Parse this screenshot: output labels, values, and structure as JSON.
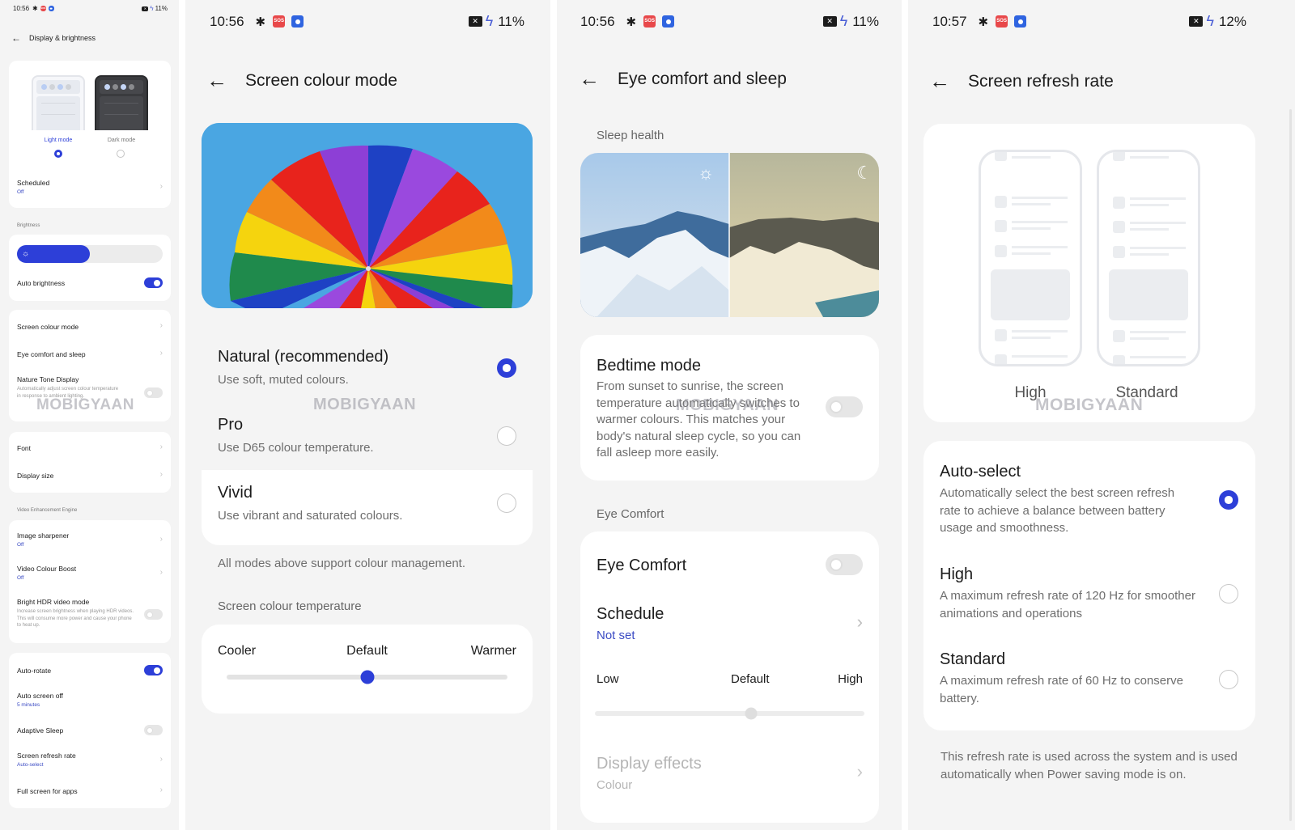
{
  "colors": {
    "accent": "#2d3fd8",
    "background": "#f4f4f4",
    "card": "#ffffff",
    "subtitle_link": "#3b4bc4",
    "secondary_text": "#6e6e6e"
  },
  "status_bars": [
    {
      "time": "10:56",
      "battery": "11%",
      "icons": [
        "gear-icon",
        "sos-icon",
        "app-icon",
        "no-sim-icon",
        "charging-bolt-icon"
      ],
      "sos": "SOS",
      "x": "✕"
    },
    {
      "time": "10:56",
      "battery": "11%",
      "icons": [
        "gear-icon",
        "sos-icon",
        "app-icon",
        "no-sim-icon",
        "charging-bolt-icon"
      ],
      "sos": "SOS",
      "x": "✕"
    },
    {
      "time": "10:56",
      "battery": "11%",
      "icons": [
        "gear-icon",
        "sos-icon",
        "app-icon",
        "no-sim-icon",
        "charging-bolt-icon"
      ],
      "sos": "SOS",
      "x": "✕"
    },
    {
      "time": "10:57",
      "battery": "12%",
      "icons": [
        "gear-icon",
        "sos-icon",
        "app-icon",
        "no-sim-icon",
        "charging-bolt-icon"
      ],
      "sos": "SOS",
      "x": "✕"
    }
  ],
  "watermark": "MOBIGYAAN",
  "display_brightness": {
    "title": "Display & brightness",
    "theme": {
      "light_label": "Light mode",
      "dark_label": "Dark mode",
      "selected": "light"
    },
    "scheduled": {
      "title": "Scheduled",
      "value": "Off"
    },
    "brightness_section": "Brightness",
    "brightness_level": 0.5,
    "auto_brightness": {
      "label": "Auto brightness",
      "on": true
    },
    "group1": [
      {
        "title": "Screen colour mode"
      },
      {
        "title": "Eye comfort and sleep"
      }
    ],
    "nature_tone": {
      "title": "Nature Tone Display",
      "desc": "Automatically adjust screen colour temperature in response to ambient lighting.",
      "on": false
    },
    "font": "Font",
    "display_size": "Display size",
    "video_section": "Video Enhancement Engine",
    "image_sharpener": {
      "title": "Image sharpener",
      "value": "Off"
    },
    "video_colour_boost": {
      "title": "Video Colour Boost",
      "value": "Off"
    },
    "bright_hdr": {
      "title": "Bright HDR video mode",
      "desc": "Increase screen brightness when playing HDR videos. This will consume more power and cause your phone to heat up.",
      "on": false
    },
    "auto_rotate": {
      "title": "Auto-rotate",
      "on": true
    },
    "auto_screen_off": {
      "title": "Auto screen off",
      "value": "5 minutes"
    },
    "adaptive_sleep": {
      "title": "Adaptive Sleep",
      "on": false
    },
    "refresh_rate": {
      "title": "Screen refresh rate",
      "value": "Auto-select"
    },
    "full_screen": {
      "title": "Full screen for apps"
    }
  },
  "screen_colour_mode": {
    "title": "Screen colour mode",
    "options": [
      {
        "title": "Natural (recommended)",
        "desc": "Use soft, muted colours.",
        "selected": true
      },
      {
        "title": "Pro",
        "desc": "Use D65 colour temperature.",
        "selected": false
      },
      {
        "title": "Vivid",
        "desc": "Use vibrant and saturated colours.",
        "selected": false
      }
    ],
    "note": "All modes above support colour management.",
    "temperature_section": "Screen colour temperature",
    "temperature": {
      "min_label": "Cooler",
      "mid_label": "Default",
      "max_label": "Warmer",
      "value": 0.5
    }
  },
  "eye_comfort_sleep": {
    "title": "Eye comfort and sleep",
    "sleep_section": "Sleep health",
    "bedtime": {
      "title": "Bedtime mode",
      "desc": "From sunset to sunrise, the screen temperature automatically switches to warmer colours. This matches your body's natural sleep cycle, so you can fall asleep more easily.",
      "on": false
    },
    "eye_section": "Eye Comfort",
    "eye_comfort": {
      "title": "Eye Comfort",
      "on": false
    },
    "schedule": {
      "title": "Schedule",
      "value": "Not set"
    },
    "intensity": {
      "min_label": "Low",
      "mid_label": "Default",
      "max_label": "High",
      "value": 0.58,
      "disabled": true
    },
    "display_effects": {
      "title": "Display effects",
      "value": "Colour",
      "disabled": true
    }
  },
  "screen_refresh_rate": {
    "title": "Screen refresh rate",
    "illustration_labels": [
      "High",
      "Standard"
    ],
    "options": [
      {
        "title": "Auto-select",
        "desc": "Automatically select the best screen refresh rate to achieve a balance between battery usage and smoothness.",
        "selected": true
      },
      {
        "title": "High",
        "desc": "A maximum refresh rate of 120 Hz for smoother animations and operations",
        "selected": false
      },
      {
        "title": "Standard",
        "desc": "A maximum refresh rate of 60 Hz to conserve battery.",
        "selected": false
      }
    ],
    "note": "This refresh rate is used across the system and is used automatically when Power saving mode is on."
  },
  "glyphs": {
    "back": "←",
    "chevron": "›",
    "gear": "✱",
    "bolt": "ϟ",
    "sun": "☼",
    "moon": "☾"
  }
}
